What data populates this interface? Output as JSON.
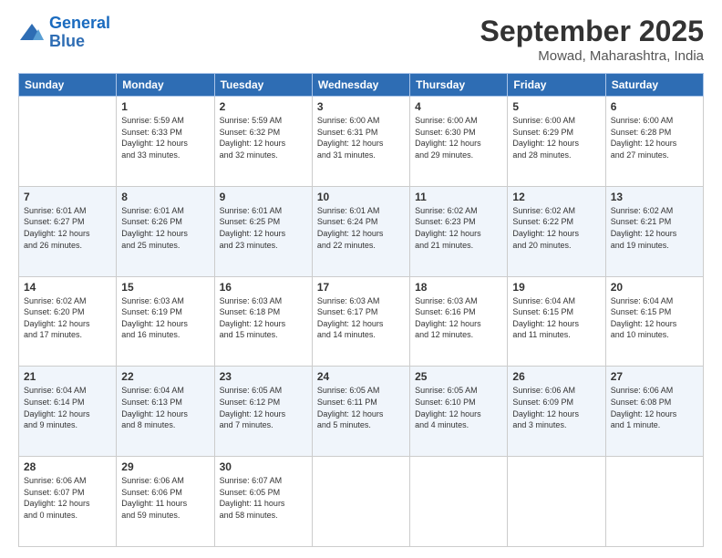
{
  "logo": {
    "line1": "General",
    "line2": "Blue"
  },
  "header": {
    "month": "September 2025",
    "location": "Mowad, Maharashtra, India"
  },
  "weekdays": [
    "Sunday",
    "Monday",
    "Tuesday",
    "Wednesday",
    "Thursday",
    "Friday",
    "Saturday"
  ],
  "weeks": [
    [
      {
        "day": "",
        "info": ""
      },
      {
        "day": "1",
        "info": "Sunrise: 5:59 AM\nSunset: 6:33 PM\nDaylight: 12 hours\nand 33 minutes."
      },
      {
        "day": "2",
        "info": "Sunrise: 5:59 AM\nSunset: 6:32 PM\nDaylight: 12 hours\nand 32 minutes."
      },
      {
        "day": "3",
        "info": "Sunrise: 6:00 AM\nSunset: 6:31 PM\nDaylight: 12 hours\nand 31 minutes."
      },
      {
        "day": "4",
        "info": "Sunrise: 6:00 AM\nSunset: 6:30 PM\nDaylight: 12 hours\nand 29 minutes."
      },
      {
        "day": "5",
        "info": "Sunrise: 6:00 AM\nSunset: 6:29 PM\nDaylight: 12 hours\nand 28 minutes."
      },
      {
        "day": "6",
        "info": "Sunrise: 6:00 AM\nSunset: 6:28 PM\nDaylight: 12 hours\nand 27 minutes."
      }
    ],
    [
      {
        "day": "7",
        "info": "Sunrise: 6:01 AM\nSunset: 6:27 PM\nDaylight: 12 hours\nand 26 minutes."
      },
      {
        "day": "8",
        "info": "Sunrise: 6:01 AM\nSunset: 6:26 PM\nDaylight: 12 hours\nand 25 minutes."
      },
      {
        "day": "9",
        "info": "Sunrise: 6:01 AM\nSunset: 6:25 PM\nDaylight: 12 hours\nand 23 minutes."
      },
      {
        "day": "10",
        "info": "Sunrise: 6:01 AM\nSunset: 6:24 PM\nDaylight: 12 hours\nand 22 minutes."
      },
      {
        "day": "11",
        "info": "Sunrise: 6:02 AM\nSunset: 6:23 PM\nDaylight: 12 hours\nand 21 minutes."
      },
      {
        "day": "12",
        "info": "Sunrise: 6:02 AM\nSunset: 6:22 PM\nDaylight: 12 hours\nand 20 minutes."
      },
      {
        "day": "13",
        "info": "Sunrise: 6:02 AM\nSunset: 6:21 PM\nDaylight: 12 hours\nand 19 minutes."
      }
    ],
    [
      {
        "day": "14",
        "info": "Sunrise: 6:02 AM\nSunset: 6:20 PM\nDaylight: 12 hours\nand 17 minutes."
      },
      {
        "day": "15",
        "info": "Sunrise: 6:03 AM\nSunset: 6:19 PM\nDaylight: 12 hours\nand 16 minutes."
      },
      {
        "day": "16",
        "info": "Sunrise: 6:03 AM\nSunset: 6:18 PM\nDaylight: 12 hours\nand 15 minutes."
      },
      {
        "day": "17",
        "info": "Sunrise: 6:03 AM\nSunset: 6:17 PM\nDaylight: 12 hours\nand 14 minutes."
      },
      {
        "day": "18",
        "info": "Sunrise: 6:03 AM\nSunset: 6:16 PM\nDaylight: 12 hours\nand 12 minutes."
      },
      {
        "day": "19",
        "info": "Sunrise: 6:04 AM\nSunset: 6:15 PM\nDaylight: 12 hours\nand 11 minutes."
      },
      {
        "day": "20",
        "info": "Sunrise: 6:04 AM\nSunset: 6:15 PM\nDaylight: 12 hours\nand 10 minutes."
      }
    ],
    [
      {
        "day": "21",
        "info": "Sunrise: 6:04 AM\nSunset: 6:14 PM\nDaylight: 12 hours\nand 9 minutes."
      },
      {
        "day": "22",
        "info": "Sunrise: 6:04 AM\nSunset: 6:13 PM\nDaylight: 12 hours\nand 8 minutes."
      },
      {
        "day": "23",
        "info": "Sunrise: 6:05 AM\nSunset: 6:12 PM\nDaylight: 12 hours\nand 7 minutes."
      },
      {
        "day": "24",
        "info": "Sunrise: 6:05 AM\nSunset: 6:11 PM\nDaylight: 12 hours\nand 5 minutes."
      },
      {
        "day": "25",
        "info": "Sunrise: 6:05 AM\nSunset: 6:10 PM\nDaylight: 12 hours\nand 4 minutes."
      },
      {
        "day": "26",
        "info": "Sunrise: 6:06 AM\nSunset: 6:09 PM\nDaylight: 12 hours\nand 3 minutes."
      },
      {
        "day": "27",
        "info": "Sunrise: 6:06 AM\nSunset: 6:08 PM\nDaylight: 12 hours\nand 1 minute."
      }
    ],
    [
      {
        "day": "28",
        "info": "Sunrise: 6:06 AM\nSunset: 6:07 PM\nDaylight: 12 hours\nand 0 minutes."
      },
      {
        "day": "29",
        "info": "Sunrise: 6:06 AM\nSunset: 6:06 PM\nDaylight: 11 hours\nand 59 minutes."
      },
      {
        "day": "30",
        "info": "Sunrise: 6:07 AM\nSunset: 6:05 PM\nDaylight: 11 hours\nand 58 minutes."
      },
      {
        "day": "",
        "info": ""
      },
      {
        "day": "",
        "info": ""
      },
      {
        "day": "",
        "info": ""
      },
      {
        "day": "",
        "info": ""
      }
    ]
  ]
}
